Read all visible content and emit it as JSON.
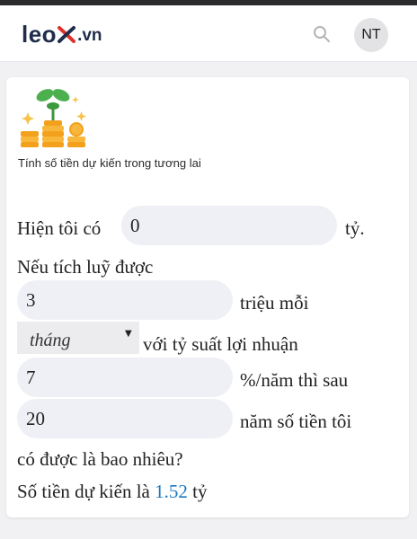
{
  "header": {
    "logo_main": "leo",
    "logo_x": "x",
    "logo_tld": ".vn",
    "avatar_initials": "NT"
  },
  "calculator": {
    "subtitle": "Tính số tiền dự kiến trong tương lai",
    "line1_prefix": "Hiện tôi có",
    "current_amount": "0",
    "line1_suffix": "tỷ.",
    "line2": "Nếu tích luỹ được",
    "monthly_amount": "3",
    "line3_suffix": "triệu mỗi",
    "period_selected": "tháng",
    "line4_suffix": "với tỷ suất lợi nhuận",
    "rate": "7",
    "line5_suffix": "%/năm thì sau",
    "years": "20",
    "line6_suffix": "năm số tiền tôi",
    "line7": "có được là bao nhiêu?",
    "result_prefix": "Số tiền dự kiến là",
    "result_value": "1.52",
    "result_unit": "tỷ"
  },
  "colors": {
    "accent": "#1c78c0",
    "logo_navy": "#1f2d4a",
    "logo_red": "#e0312b",
    "input_bg": "#eff0f5"
  },
  "icons": [
    "search-icon",
    "coin-stack-plant-illustration",
    "dropdown-arrow-icon"
  ]
}
